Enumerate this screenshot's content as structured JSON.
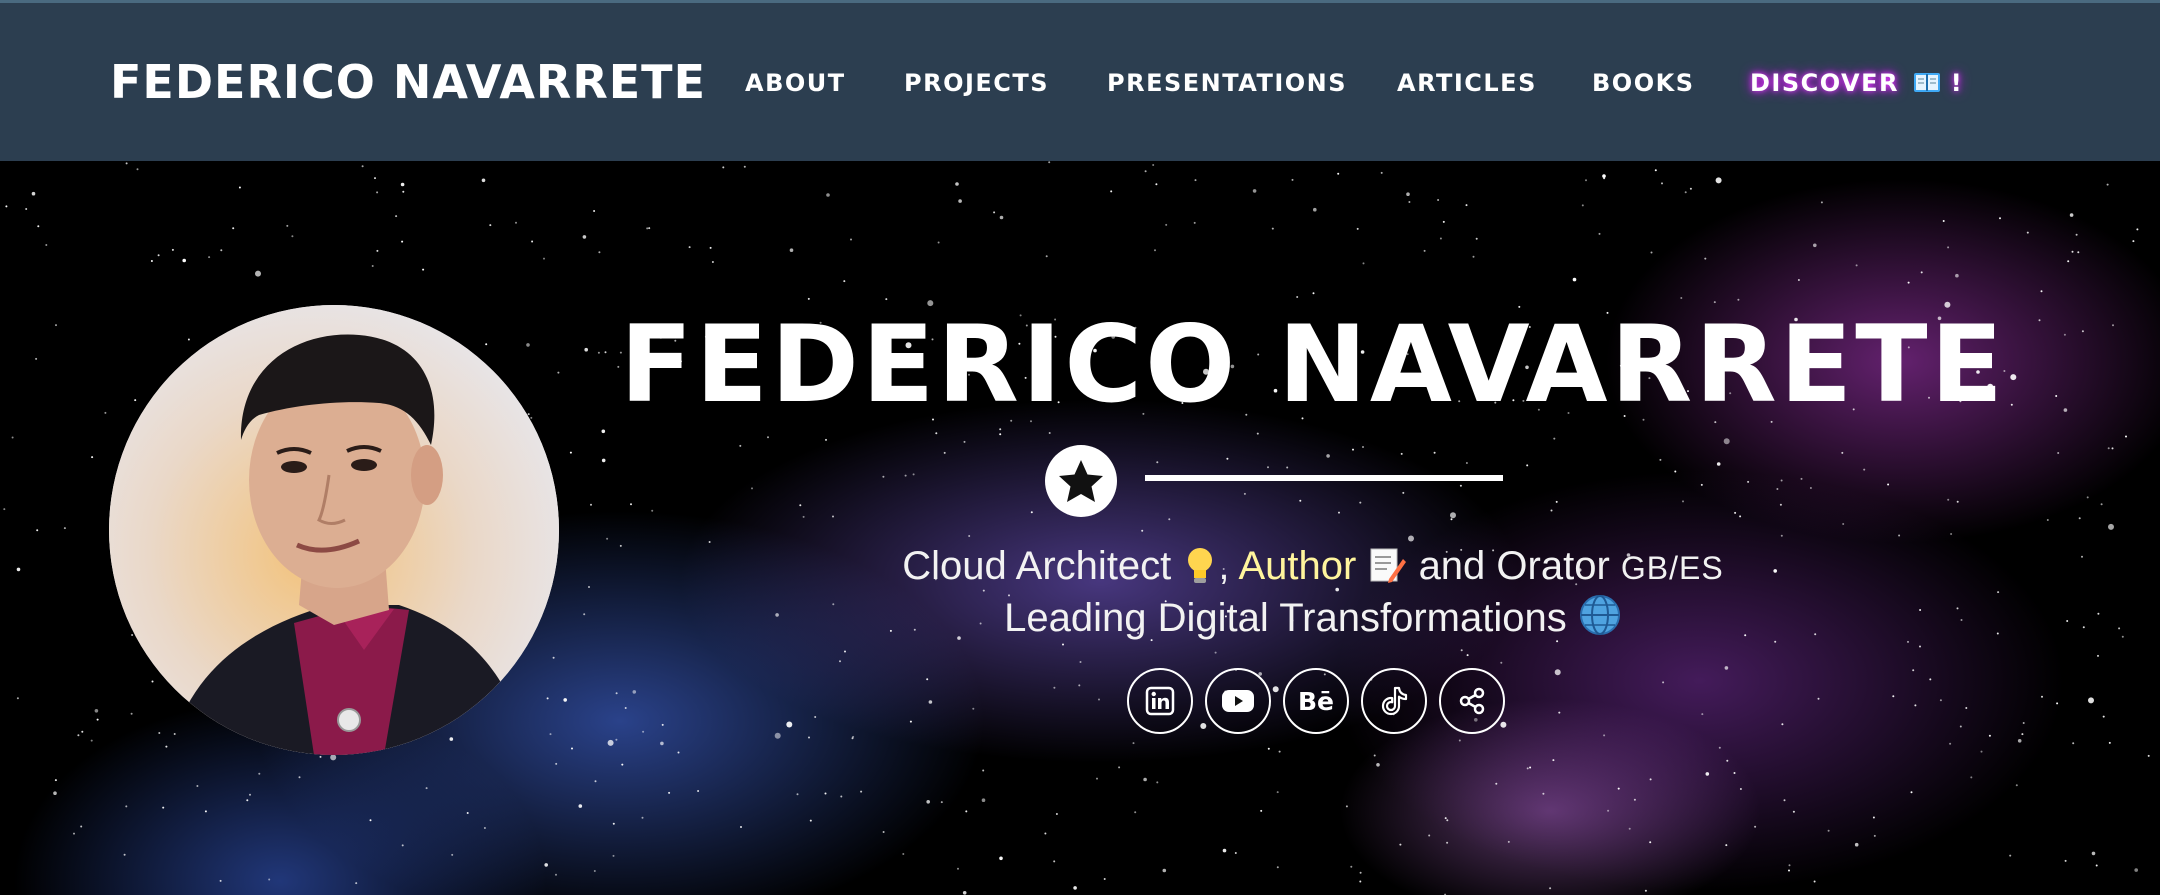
{
  "nav": {
    "brand": "FEDERICO NAVARRETE",
    "links": [
      {
        "label": "ABOUT"
      },
      {
        "label": "PROJECTS"
      },
      {
        "label": "PRESENTATIONS"
      },
      {
        "label": "ARTICLES"
      },
      {
        "label": "BOOKS"
      }
    ],
    "discover": {
      "label": "DISCOVER",
      "suffix": "!",
      "icon": "open-book-icon"
    }
  },
  "hero": {
    "title": "FEDERICO NAVARRETE",
    "divider_icon": "star-icon",
    "tagline": {
      "role1": "Cloud Architect",
      "role1_icon": "lightbulb-icon",
      "sep": ",",
      "role2": "Author",
      "role2_icon": "memo-icon",
      "role3_prefix": "and Orator",
      "langs": "GB/ES",
      "line2": "Leading Digital Transformations",
      "line2_icon": "globe-icon"
    },
    "socials": [
      {
        "name": "linkedin",
        "icon": "linkedin-icon"
      },
      {
        "name": "youtube",
        "icon": "youtube-icon"
      },
      {
        "name": "behance",
        "icon": "behance-icon",
        "text": "Bē"
      },
      {
        "name": "tiktok",
        "icon": "tiktok-icon"
      },
      {
        "name": "share",
        "icon": "share-icon"
      }
    ]
  },
  "colors": {
    "navbar": "#2c3e50",
    "author_highlight": "#fff59d",
    "discover_glow": "#e040fb"
  }
}
